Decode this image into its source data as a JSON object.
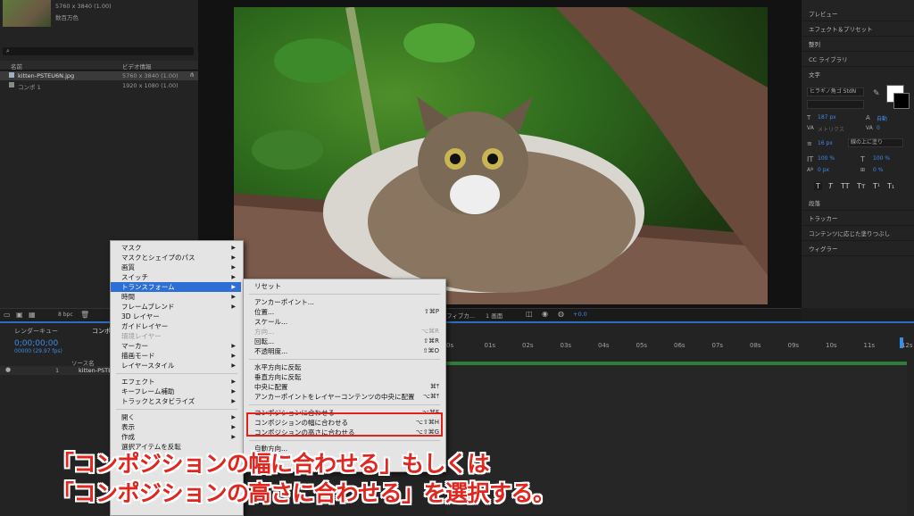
{
  "project": {
    "thumb_info1": "5760 x 3840 (1.00)",
    "thumb_info2": "数百万色",
    "col_name": "名前",
    "col_video": "ビデオ情報",
    "items": [
      {
        "name": "kitten-PSTEU6N.jpg",
        "info": "5760 x 3840 (1.00)"
      },
      {
        "name": "コンポ 1",
        "info": "1920 x 1080 (1.00)"
      }
    ],
    "bpc": "8 bpc"
  },
  "right_panel": {
    "items": [
      "プレビュー",
      "エフェクト＆プリセット",
      "整列",
      "CC ライブラリ",
      "文字"
    ],
    "font": "ヒラギノ角ゴ StdN",
    "size": "187 px",
    "auto": "自動",
    "tracking_label": "メトリクス",
    "tracking_val": "0",
    "stroke": "16 px",
    "stroke_mode": "線の上に塗り",
    "scale_v": "100 %",
    "scale_h": "100 %",
    "baseline": "0 px",
    "tsume": "0 %",
    "styles": [
      "T",
      "T",
      "TT",
      "Tт",
      "T¹",
      "T₁"
    ],
    "bottom_items": [
      "段落",
      "トラッカー",
      "コンテンツに応じた塗りつぶし",
      "ウィグラー"
    ]
  },
  "viewer": {
    "quality": "フィブカ...",
    "screen": "1 画面",
    "offset": "+0.0"
  },
  "timeline": {
    "tab_render": "レンダーキュー",
    "tab_comp": "コンポ",
    "timecode": "0;00;00;00",
    "fps": "00000 (29.97 fps)",
    "source_name": "ソース名",
    "layer_num": "1",
    "layer_name": "kitten-PSTE",
    "ruler": [
      "0s",
      "01s",
      "02s",
      "03s",
      "04s",
      "05s",
      "06s",
      "07s",
      "08s",
      "09s",
      "10s",
      "11s",
      "12s"
    ]
  },
  "menu1": [
    {
      "label": "マスク",
      "arrow": true
    },
    {
      "label": "マスクとシェイプのパス",
      "arrow": true
    },
    {
      "label": "画質",
      "arrow": true
    },
    {
      "label": "スイッチ",
      "arrow": true
    },
    {
      "label": "トランスフォーム",
      "arrow": true,
      "highlight": true
    },
    {
      "label": "時間",
      "arrow": true
    },
    {
      "label": "フレームブレンド",
      "arrow": true
    },
    {
      "label": "3D レイヤー"
    },
    {
      "label": "ガイドレイヤー"
    },
    {
      "label": "環境レイヤー",
      "disabled": true
    },
    {
      "label": "マーカー",
      "arrow": true
    },
    {
      "label": "描画モード",
      "arrow": true
    },
    {
      "label": "レイヤースタイル",
      "arrow": true
    },
    {
      "label": "エフェクト",
      "arrow": true
    },
    {
      "label": "キーフレーム補助",
      "arrow": true
    },
    {
      "label": "トラックとスタビライズ",
      "arrow": true
    },
    {
      "label": "開く",
      "arrow": true
    },
    {
      "label": "表示",
      "arrow": true
    },
    {
      "label": "作成",
      "arrow": true
    },
    {
      "label": "選択アイテムを反転"
    }
  ],
  "menu2": [
    {
      "label": "リセット",
      "sc": ""
    },
    {
      "label": "アンカーポイント...",
      "sc": ""
    },
    {
      "label": "位置...",
      "sc": "⇧⌘P"
    },
    {
      "label": "スケール...",
      "sc": ""
    },
    {
      "label": "方向...",
      "sc": "⌥⌘R",
      "disabled": true
    },
    {
      "label": "回転...",
      "sc": "⇧⌘R"
    },
    {
      "label": "不透明度...",
      "sc": "⇧⌘O"
    },
    {
      "label": "水平方向に反転",
      "sc": ""
    },
    {
      "label": "垂直方向に反転",
      "sc": ""
    },
    {
      "label": "中央に配置",
      "sc": "⌘⤒"
    },
    {
      "label": "アンカーポイントをレイヤーコンテンツの中央に配置",
      "sc": "⌥⌘⤒"
    },
    {
      "label": "コンポジションに合わせる",
      "sc": "⌥⌘F"
    },
    {
      "label": "コンポジションの幅に合わせる",
      "sc": "⌥⇧⌘H"
    },
    {
      "label": "コンポジションの高さに合わせる",
      "sc": "⌥⇧⌘G"
    },
    {
      "label": "自動方向...",
      "sc": ""
    }
  ],
  "caption": {
    "line1": "「コンポジションの幅に合わせる」もしくは",
    "line2": "「コンポジションの高さに合わせる」を選択する。"
  },
  "colors": {
    "highlight": "#2e6fd6",
    "caption_red": "#e0261e",
    "redbox": "#e0221b"
  }
}
